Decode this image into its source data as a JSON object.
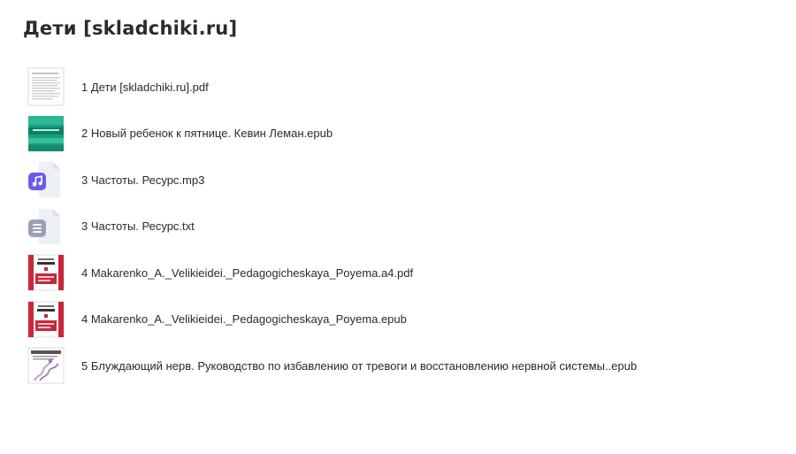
{
  "folder": {
    "title": "Дети [skladchiki.ru]"
  },
  "files": [
    {
      "name": "1 Дети [skladchiki.ru].pdf",
      "thumb": "document-page-thumbnail"
    },
    {
      "name": "2 Новый ребенок к пятнице. Кевин Леман.epub",
      "thumb": "green-book-cover-thumbnail"
    },
    {
      "name": "3 Частоты. Ресурс.mp3",
      "thumb": "music-note-icon"
    },
    {
      "name": "3 Частоты. Ресурс.txt",
      "thumb": "text-file-icon"
    },
    {
      "name": "4 Makarenko_A._Velikieidei._Pedagogicheskaya_Poyema.a4.pdf",
      "thumb": "red-book-cover-thumbnail"
    },
    {
      "name": "4 Makarenko_A._Velikieidei._Pedagogicheskaya_Poyema.epub",
      "thumb": "red-book-cover-thumbnail"
    },
    {
      "name": "5 Блуждающий нерв. Руководство по избавлению от тревоги и восстановлению нервной системы..epub",
      "thumb": "nerve-book-cover-thumbnail"
    }
  ],
  "colors": {
    "music_icon": "#6c5ce7",
    "text_icon": "#9aa0b4",
    "file_bg": "#eef0f8",
    "green_cover": "#1a9e7d",
    "red_cover": "#c8283c"
  }
}
